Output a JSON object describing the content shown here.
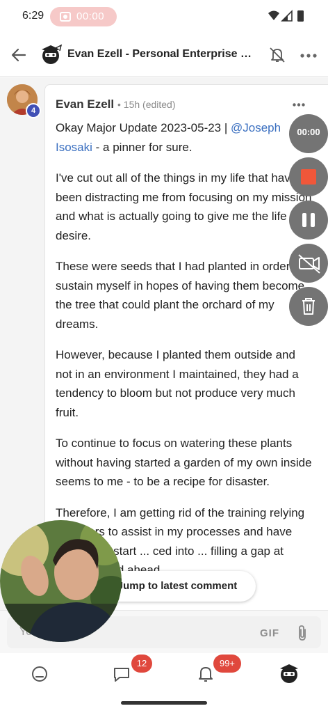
{
  "status_bar": {
    "time": "6:29",
    "recording_time": "00:00"
  },
  "header": {
    "title": "Evan Ezell - Personal Enterprise Sol..."
  },
  "post": {
    "avatar_badge": "4",
    "author": "Evan Ezell",
    "meta": "• 15h (edited)",
    "paragraphs": [
      {
        "prefix": "Okay Major Update 2023-05-23 | ",
        "mention": "@Joseph Isosaki",
        "suffix": " - a pinner for sure."
      },
      {
        "text": "I've cut out all of the things in my life that have been distracting me from focusing on my mission and what is actually going to give me the life I desire."
      },
      {
        "text": "These were seeds that I had planted in order to sustain myself in hopes of having them become the tree that could plant the orchard of my dreams."
      },
      {
        "text": "However, because I planted them outside and not in an environment I maintained, they had a tendency to bloom but not produce very much fruit."
      },
      {
        "text": "To continue to focus on watering these plants without having started a garden of my own inside seems to me - to be a recipe for disaster."
      },
      {
        "text": "Therefore, I am getting rid of the training relying on others to assist in my processes and have decided to start ... ced into ... filling a gap at ent/stretched ahead"
      }
    ]
  },
  "recording_controls": {
    "timer": "00:00"
  },
  "jump_button": {
    "label": "Jump to latest comment"
  },
  "composer": {
    "placeholder": "Your comment",
    "gif_label": "GIF"
  },
  "bottom_nav": {
    "chat_badge": "12",
    "notifications_badge": "99+"
  },
  "colors": {
    "mention": "#3a6fc0",
    "badge": "#e0483d",
    "avatar_badge": "#4150b5",
    "stop": "#f0573a",
    "control_bg": "#747474"
  },
  "icons": [
    "back-arrow-icon",
    "bell-off-icon",
    "more-horizontal-icon",
    "stop-icon",
    "pause-icon",
    "camera-switch-icon",
    "trash-icon",
    "paperclip-icon",
    "home-icon",
    "chat-icon",
    "bell-icon"
  ]
}
